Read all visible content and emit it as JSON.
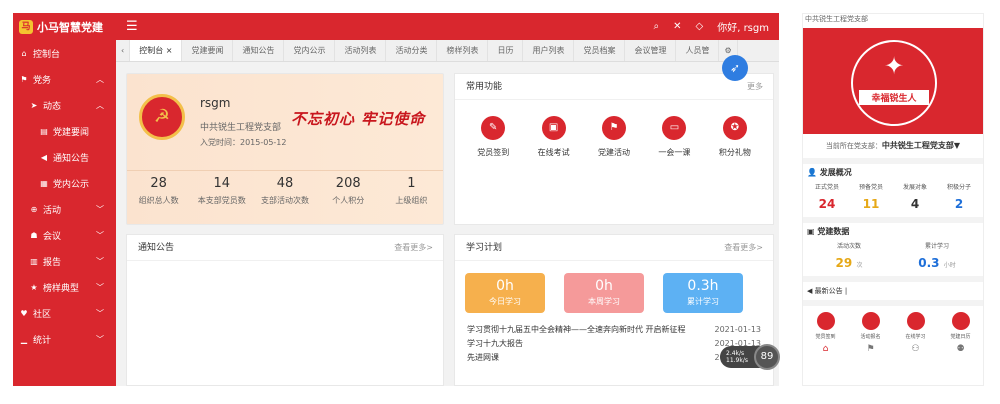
{
  "app": {
    "title": "小马智慧党建",
    "user": "你好, rsgm"
  },
  "sidebar": {
    "items": [
      {
        "label": "控制台",
        "icon": "home-icon",
        "level": 1
      },
      {
        "label": "党务",
        "icon": "flag-icon",
        "level": 1
      },
      {
        "label": "动态",
        "icon": "send-icon",
        "level": 2
      },
      {
        "label": "党建要闻",
        "icon": "doc-icon",
        "level": 3
      },
      {
        "label": "通知公告",
        "icon": "speaker-icon",
        "level": 3
      },
      {
        "label": "党内公示",
        "icon": "list-icon",
        "level": 3
      },
      {
        "label": "活动",
        "icon": "activity-icon",
        "level": 2
      },
      {
        "label": "会议",
        "icon": "users-icon",
        "level": 2
      },
      {
        "label": "报告",
        "icon": "chart-icon",
        "level": 2
      },
      {
        "label": "榜样典型",
        "icon": "star-icon",
        "level": 2
      },
      {
        "label": "社区",
        "icon": "heart-icon",
        "level": 1
      },
      {
        "label": "统计",
        "icon": "stats-icon",
        "level": 1
      }
    ]
  },
  "tabs": [
    "控制台",
    "党建要闻",
    "通知公告",
    "党内公示",
    "活动列表",
    "活动分类",
    "榜样列表",
    "日历",
    "用户列表",
    "党员档案",
    "会议管理",
    "人员管"
  ],
  "profile": {
    "name": "rsgm",
    "org": "中共锐生工程党支部",
    "joined": "入党时间：2015-05-12",
    "slogan": "不忘初心 牢记使命",
    "stats": [
      {
        "value": "28",
        "label": "组织总人数"
      },
      {
        "value": "14",
        "label": "本支部党员数"
      },
      {
        "value": "48",
        "label": "支部活动次数"
      },
      {
        "value": "208",
        "label": "个人积分"
      },
      {
        "value": "1",
        "label": "上级组织"
      }
    ]
  },
  "apps": {
    "title": "常用功能",
    "more": "更多",
    "items": [
      {
        "label": "党员签到"
      },
      {
        "label": "在线考试"
      },
      {
        "label": "党建活动"
      },
      {
        "label": "一会一课"
      },
      {
        "label": "积分礼物"
      }
    ]
  },
  "notice": {
    "title": "通知公告",
    "more": "查看更多>"
  },
  "study": {
    "title": "学习计划",
    "more": "查看更多>",
    "boxes": [
      {
        "value": "0h",
        "label": "今日学习",
        "color": "#f6b04d"
      },
      {
        "value": "0h",
        "label": "本周学习",
        "color": "#f59a9a"
      },
      {
        "value": "0.3h",
        "label": "累计学习",
        "color": "#5db1f3"
      }
    ],
    "items": [
      {
        "title": "学习贯彻十九届五中全会精神——全速奔向新时代 开启新征程",
        "date": "2021-01-13"
      },
      {
        "title": "学习十九大报告",
        "date": "2021-01-13"
      },
      {
        "title": "先进网课",
        "date": "2020-11-12"
      }
    ]
  },
  "speed": {
    "up": "2.4k/s",
    "down": "11.9k/s",
    "pct": "89"
  },
  "mobile": {
    "title": "中共锐生工程党支部",
    "brand": "幸福锐生人",
    "org_label": "当前所在党支部：",
    "org": "中共锐生工程党支部▼",
    "dev_title": "发展概况",
    "dev": [
      {
        "label": "正式党员",
        "value": "24",
        "color": "#d9272e"
      },
      {
        "label": "预备党员",
        "value": "11",
        "color": "#e6a817"
      },
      {
        "label": "发展对象",
        "value": "4",
        "color": "#333"
      },
      {
        "label": "积极分子",
        "value": "2",
        "color": "#1e6fd9"
      }
    ],
    "data_title": "党建数据",
    "data": [
      {
        "label": "活动次数",
        "value": "29",
        "unit": "次",
        "color": "#e6a817"
      },
      {
        "label": "累计学习",
        "value": "0.3",
        "unit": "小时",
        "color": "#1e6fd9"
      }
    ],
    "ann": "最新公告 |",
    "apps": [
      {
        "label": "党员签到"
      },
      {
        "label": "活动报名"
      },
      {
        "label": "在线学习"
      },
      {
        "label": "党建日历"
      }
    ],
    "nav": [
      "⌂",
      "⚑",
      "⚇",
      "⚉"
    ]
  }
}
